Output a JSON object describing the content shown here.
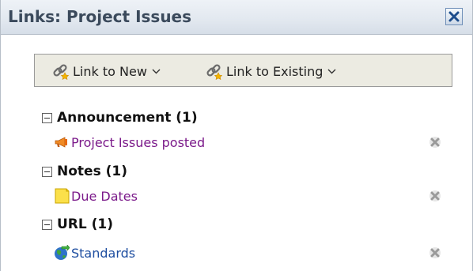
{
  "panel": {
    "title": "Links: Project Issues"
  },
  "toolbar": {
    "link_to_new_label": "Link to New",
    "link_to_existing_label": "Link to Existing"
  },
  "sections": [
    {
      "title": "Announcement (1)",
      "items": [
        {
          "label": "Project Issues posted",
          "icon": "megaphone-icon"
        }
      ]
    },
    {
      "title": "Notes (1)",
      "items": [
        {
          "label": "Due Dates",
          "icon": "note-icon"
        }
      ]
    },
    {
      "title": "URL (1)",
      "items": [
        {
          "label": "Standards",
          "icon": "globe-icon"
        }
      ]
    }
  ],
  "colors": {
    "visited_link": "#7b1a8a",
    "link": "#1e4ea0",
    "title_text": "#3b4a5c",
    "toolbar_bg": "#ecebe2"
  }
}
